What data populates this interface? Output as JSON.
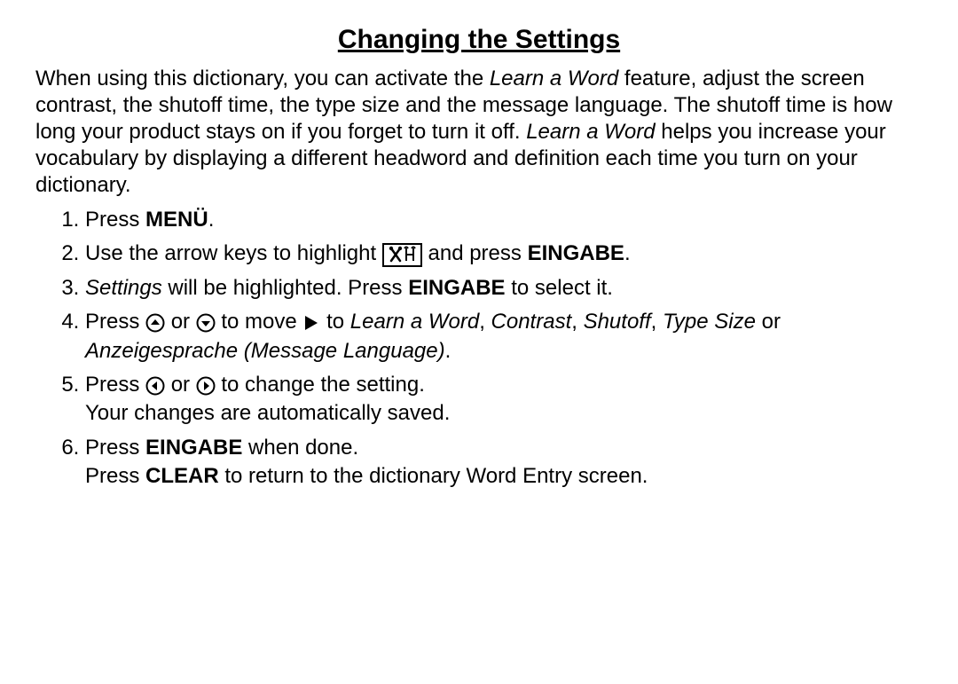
{
  "title": "Changing the Settings",
  "intro": {
    "prefix": "When using this dictionary, you can activate the ",
    "em1": "Learn a Word",
    "mid1": " feature, adjust the screen contrast, the shutoff time, the type size and the message language. The shutoff time is how long your product stays on if you forget to turn it off. ",
    "em2": "Learn a Word",
    "suffix": " helps you increase your vocabulary by displaying a different headword and definition each time you turn on your dictionary."
  },
  "steps": {
    "s1": {
      "pre": "Press ",
      "b": "MENÜ",
      "post": "."
    },
    "s2": {
      "pre": "Use the arrow keys to highlight ",
      "mid": " and press ",
      "b": "EINGABE",
      "post": "."
    },
    "s3": {
      "em": "Settings",
      "mid": " will be highlighted. Press ",
      "b": "EINGABE",
      "post": " to select it."
    },
    "s4": {
      "pre": "Press ",
      "or": " or ",
      "to_move": " to move ",
      "to": " to ",
      "e1": "Learn a Word",
      "c1": ", ",
      "e2": "Contrast",
      "c2": ", ",
      "e3": "Shutoff",
      "c3": ", ",
      "e4": "Type Size",
      "or2": " or ",
      "e5": "Anzeigesprache (Message Language)",
      "post": "."
    },
    "s5": {
      "pre": "Press ",
      "or": " or ",
      "post": " to change the setting.",
      "line2": "Your changes are automatically saved."
    },
    "s6": {
      "pre": "Press ",
      "b1": "EINGABE",
      "mid": " when done.",
      "l2a": "Press ",
      "b2": "CLEAR",
      "l2b": " to return to the dictionary Word Entry screen."
    }
  }
}
